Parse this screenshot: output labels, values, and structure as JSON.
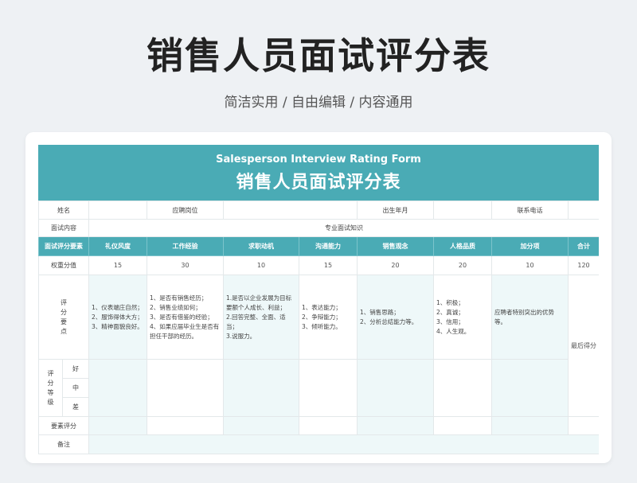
{
  "page": {
    "title": "销售人员面试评分表",
    "subtitle": "简洁实用 / 自由编辑 / 内容通用"
  },
  "form": {
    "title_en": "Salesperson Interview Rating Form",
    "title_zh": "销售人员面试评分表",
    "info": {
      "name_label": "姓名",
      "position_label": "应聘岗位",
      "birth_label": "出生年月",
      "phone_label": "联系电话",
      "content_label": "面试内容",
      "content_value": "专业面试知识"
    },
    "header": {
      "element_label": "面试评分要素",
      "columns": [
        "礼仪风度",
        "工作经验",
        "求职动机",
        "沟通能力",
        "销售观念",
        "人格品质",
        "加分项"
      ],
      "total_label": "合计"
    },
    "weight": {
      "label": "权重分值",
      "values": [
        "15",
        "30",
        "10",
        "15",
        "20",
        "20",
        "10"
      ],
      "total": "120"
    },
    "points": {
      "label": "评\n分\n要\n点",
      "items": [
        "1、仪表端庄自然；\n2、服饰得体大方；\n3、精神面貌良好。",
        "1、是否有销售经历；\n2、销售业绩如何；\n3、是否有借鉴的经验；\n4、如果应届毕业生是否有担任干部的经历。",
        "1.是否以企业发展为目标要额个人成长、利益；\n2.回答完整、全面、适当；\n3.说服力。",
        "1、表达能力；\n2、争辩能力；\n3、倾听能力。",
        "1、销售思路；\n2、分析总结能力等。",
        "1、积极；\n2、真诚；\n3、信用；\n4、人生观。",
        "应聘者特别突出的优势等。"
      ],
      "total_note": "最后得分"
    },
    "grade": {
      "label": "评\n分\n等\n级",
      "levels": [
        "好",
        "中",
        "差"
      ]
    },
    "element_score_label": "要素评分",
    "remark_label": "备注"
  },
  "colors": {
    "accent": "#4aabb5",
    "pale": "#eef8f9"
  }
}
